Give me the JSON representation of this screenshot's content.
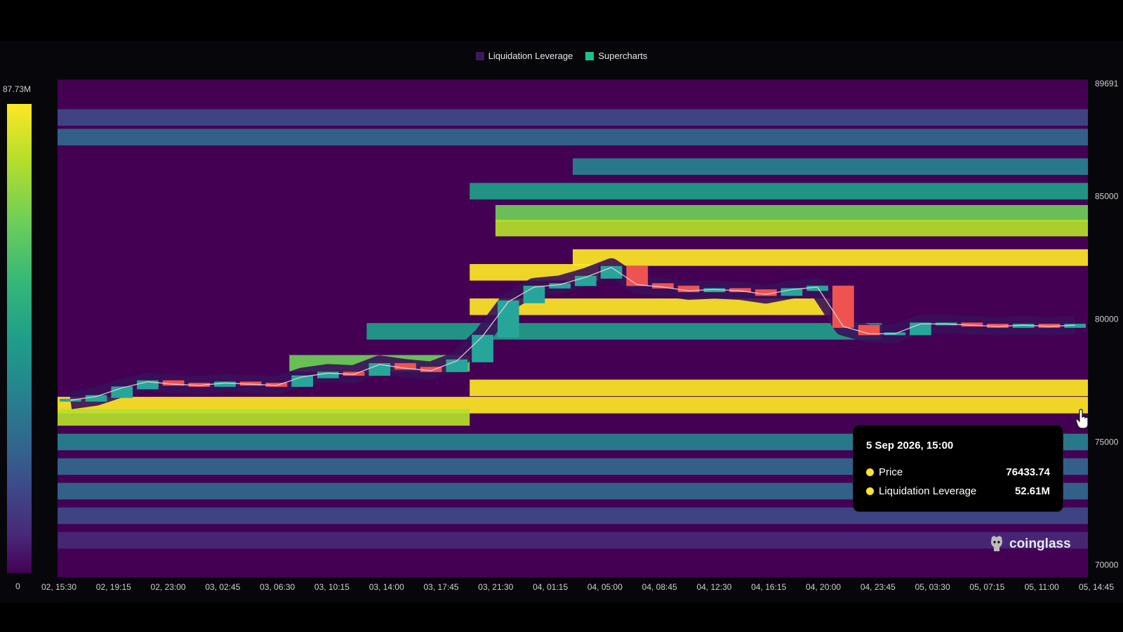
{
  "legend": {
    "items": [
      {
        "label": "Liquidation Leverage",
        "color": "#3b1a5a"
      },
      {
        "label": "Supercharts",
        "color": "#1fc08a"
      }
    ]
  },
  "colorbar": {
    "max_label": "87.73M",
    "min_label": "0"
  },
  "tooltip": {
    "title": "5 Sep 2026, 15:00",
    "rows": [
      {
        "label": "Price",
        "value": "76433.74"
      },
      {
        "label": "Liquidation Leverage",
        "value": "52.61M"
      }
    ]
  },
  "brand": {
    "name": "coinglass"
  },
  "icons": {
    "brand": "coinglass-logo-icon",
    "cursor": "hand-pointer-icon"
  },
  "chart_data": {
    "type": "heatmap",
    "x_labels": [
      "02, 15:30",
      "02, 19:15",
      "02, 23:00",
      "03, 02:45",
      "03, 06:30",
      "03, 10:15",
      "03, 14:00",
      "03, 17:45",
      "03, 21:30",
      "04, 01:15",
      "04, 05:00",
      "04, 08:45",
      "04, 12:30",
      "04, 16:15",
      "04, 20:00",
      "04, 23:45",
      "05, 03:30",
      "05, 07:15",
      "05, 11:00",
      "05, 14:45"
    ],
    "y_ticks": [
      70000,
      75000,
      80000,
      85000,
      89691
    ],
    "ylim": [
      69500,
      89691
    ],
    "color_range": [
      0,
      87.73
    ],
    "color_unit": "M",
    "colorscale": [
      "#440154",
      "#482878",
      "#3e4989",
      "#31688e",
      "#26828e",
      "#1f9e89",
      "#35b779",
      "#6ece58",
      "#b5de2b",
      "#fde725"
    ],
    "series": [
      {
        "name": "Price",
        "values": [
          76700,
          76850,
          77200,
          77450,
          77350,
          77300,
          77400,
          77350,
          77300,
          77650,
          77800,
          77750,
          78150,
          78000,
          77900,
          78300,
          79300,
          80700,
          81300,
          81400,
          81700,
          82100,
          81400,
          81300,
          81150,
          81200,
          81150,
          81000,
          81200,
          81300,
          79700,
          79400,
          79400,
          79800,
          79800,
          79750,
          79700,
          79750,
          79700,
          79750
        ]
      },
      {
        "name": "Liquidation Leverage",
        "bands": [
          {
            "price": 89400,
            "start": 0,
            "end": 40,
            "level": 0.02
          },
          {
            "price": 88200,
            "start": 0,
            "end": 40,
            "level": 0.18
          },
          {
            "price": 87400,
            "start": 0,
            "end": 40,
            "level": 0.28
          },
          {
            "price": 86200,
            "start": 20,
            "end": 40,
            "level": 0.45
          },
          {
            "price": 85200,
            "start": 16,
            "end": 40,
            "level": 0.55
          },
          {
            "price": 84300,
            "start": 17,
            "end": 40,
            "level": 0.75
          },
          {
            "price": 83700,
            "start": 17,
            "end": 40,
            "level": 0.9
          },
          {
            "price": 82500,
            "start": 20,
            "end": 40,
            "level": 1.0
          },
          {
            "price": 81900,
            "start": 16,
            "end": 21,
            "level": 1.0
          },
          {
            "price": 80500,
            "start": 16,
            "end": 30,
            "level": 0.98
          },
          {
            "price": 79500,
            "start": 12,
            "end": 32,
            "level": 0.55
          },
          {
            "price": 78200,
            "start": 9,
            "end": 16,
            "level": 0.8
          },
          {
            "price": 77200,
            "start": 16,
            "end": 40,
            "level": 1.0
          },
          {
            "price": 76500,
            "start": 0,
            "end": 40,
            "level": 0.95
          },
          {
            "price": 76000,
            "start": 0,
            "end": 16,
            "level": 0.85
          },
          {
            "price": 75000,
            "start": 0,
            "end": 40,
            "level": 0.42
          },
          {
            "price": 74000,
            "start": 0,
            "end": 40,
            "level": 0.35
          },
          {
            "price": 73000,
            "start": 0,
            "end": 40,
            "level": 0.28
          },
          {
            "price": 72000,
            "start": 0,
            "end": 40,
            "level": 0.2
          },
          {
            "price": 71000,
            "start": 0,
            "end": 40,
            "level": 0.1
          }
        ]
      }
    ],
    "grid": false,
    "legend_position": "top-center"
  }
}
